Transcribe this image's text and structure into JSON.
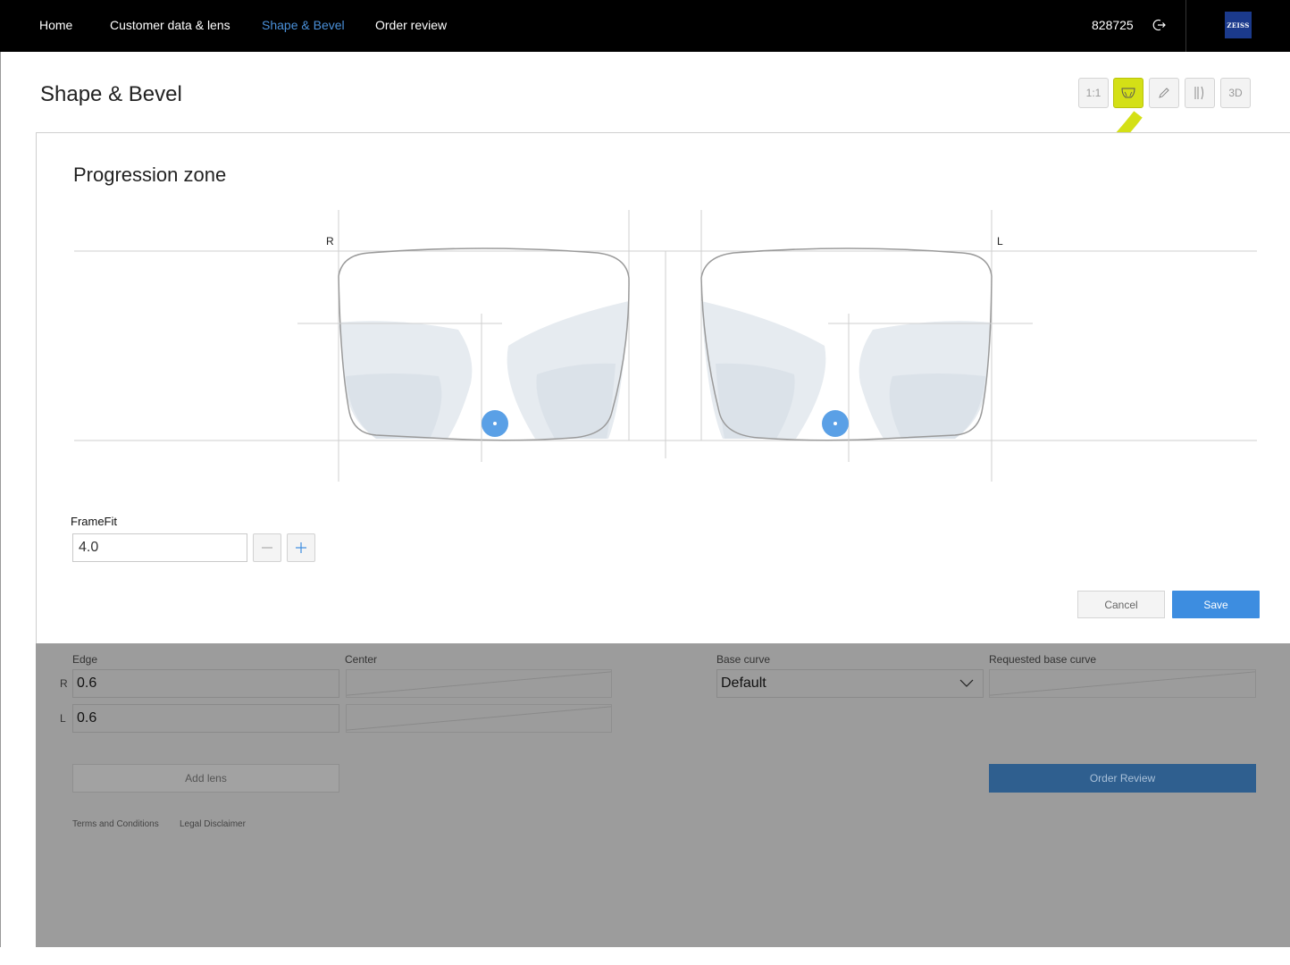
{
  "nav": {
    "items": [
      {
        "label": "Home"
      },
      {
        "label": "Customer data & lens"
      },
      {
        "label": "Shape & Bevel",
        "active": true
      },
      {
        "label": "Order review"
      }
    ],
    "user_id": "828725",
    "logo_text": "ZEISS"
  },
  "page": {
    "title": "Shape & Bevel"
  },
  "toolbar": {
    "buttons": [
      {
        "label": "1:1",
        "icon": "scale-icon"
      },
      {
        "label": "",
        "icon": "progression-zone-icon",
        "active": true
      },
      {
        "label": "",
        "icon": "pencil-icon"
      },
      {
        "label": "",
        "icon": "bevel-icon"
      },
      {
        "label": "3D",
        "icon": "3d-icon"
      }
    ]
  },
  "modal": {
    "title": "Progression zone",
    "right_label": "R",
    "left_label": "L",
    "framefit_label": "FrameFit",
    "framefit_value": "4.0",
    "cancel_label": "Cancel",
    "save_label": "Save"
  },
  "dimensions": {
    "edge_label": "Edge",
    "center_label": "Center",
    "base_curve_label": "Base curve",
    "requested_base_curve_label": "Requested base curve",
    "row_r": "R",
    "row_l": "L",
    "edge_r": "0.6",
    "edge_l": "0.6",
    "base_curve_value": "Default",
    "add_lens_label": "Add lens",
    "order_review_label": "Order Review"
  },
  "footer": {
    "terms": "Terms and Conditions",
    "legal": "Legal Disclaimer"
  },
  "colors": {
    "accent_yellow": "#d4e016",
    "nav_active": "#4a90d9",
    "save_blue": "#3d8de0",
    "marker_blue": "#5aa0e6"
  }
}
